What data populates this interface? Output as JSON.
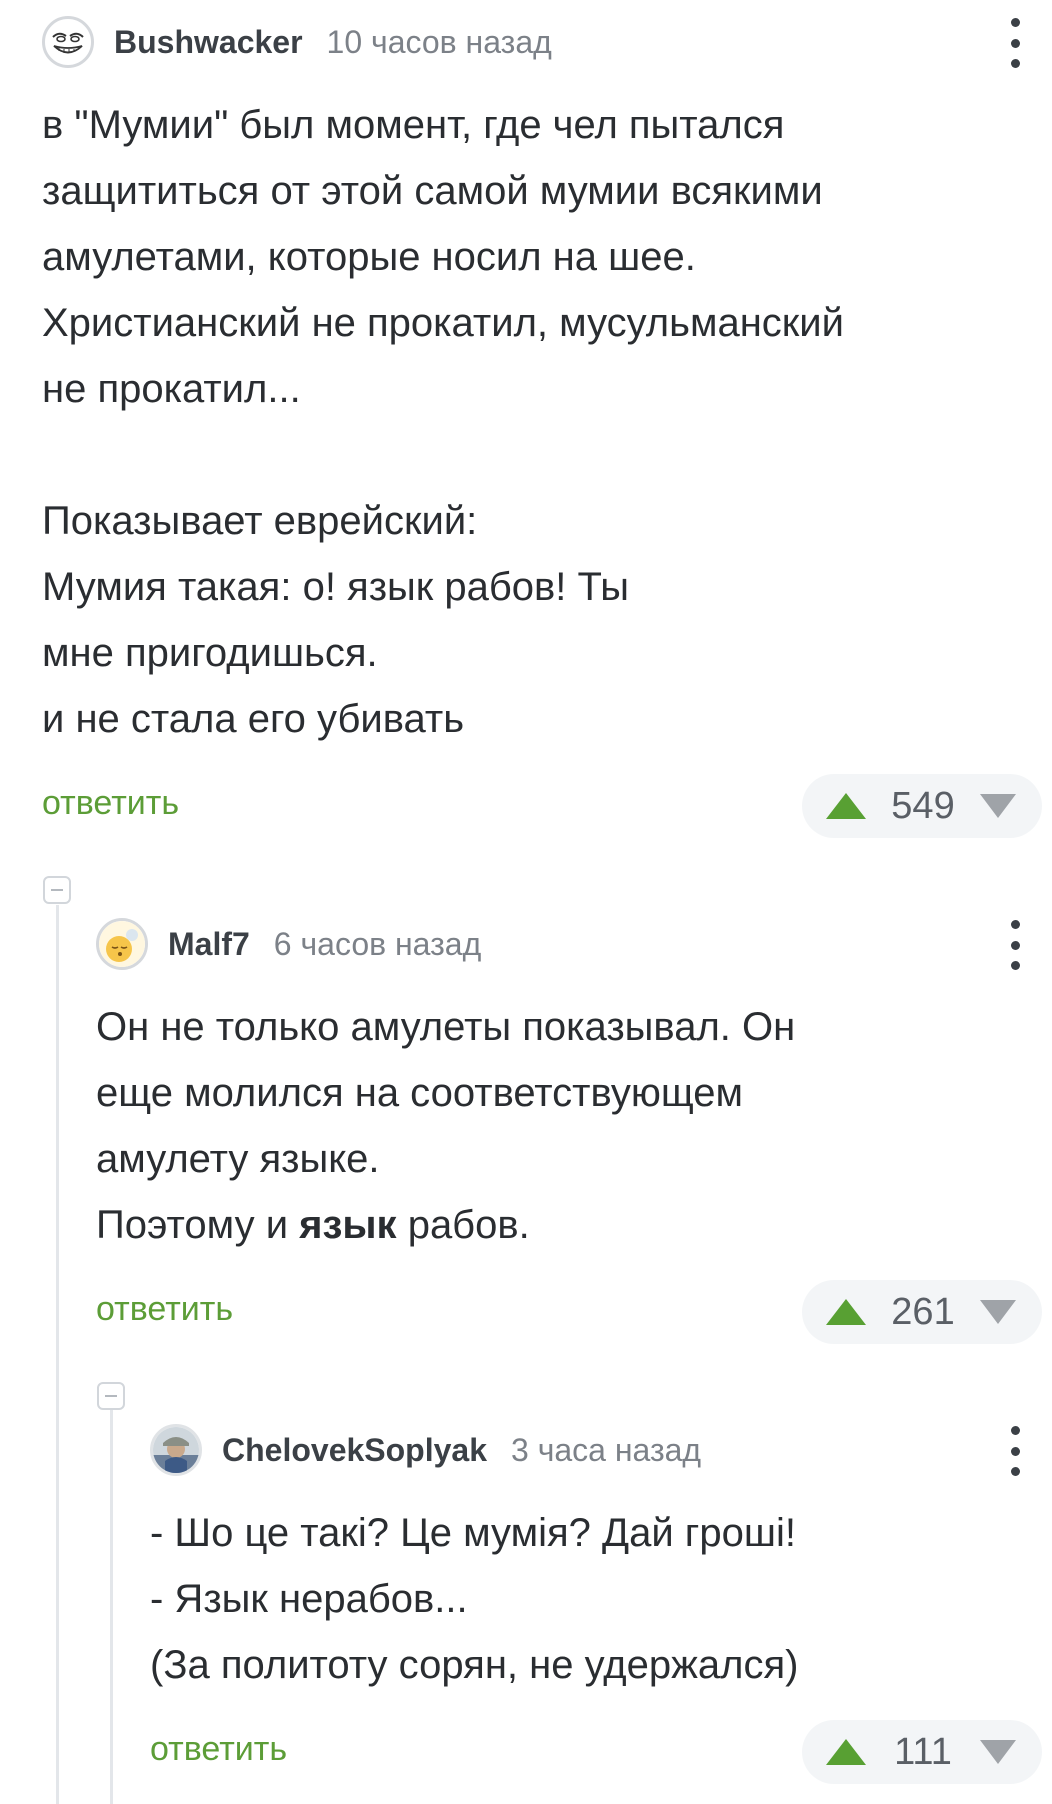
{
  "comments": [
    {
      "username": "Bushwacker",
      "time": "10 часов назад",
      "lines": [
        "в \"Мумии\" был момент, где чел пытался",
        "защититься от этой самой мумии всякими",
        "амулетами, которые носил на шее.",
        "Христианский не прокатил, мусульманский",
        "не прокатил...",
        "",
        "Показывает еврейский:",
        "Мумия такая: о! язык рабов! Ты",
        "мне пригодишься.",
        "и не стала его убивать"
      ],
      "reply_label": "ответить",
      "votes": "549"
    },
    {
      "username": "Malf7",
      "time": "6 часов назад",
      "lines": [
        "Он не только амулеты показывал. Он",
        "еще молился на соответствующем",
        "амулету языке."
      ],
      "last_line": {
        "before": "Поэтому и ",
        "bold": "язык",
        "after": " рабов."
      },
      "reply_label": "ответить",
      "votes": "261"
    },
    {
      "username": "ChelovekSoplyak",
      "time": "3 часа назад",
      "lines": [
        "- Шо це такі? Це мумія? Дай гроші!",
        "- Язык нерабов...",
        "(За политоту сорян, не удержался)"
      ],
      "reply_label": "ответить",
      "votes": "111"
    }
  ],
  "colors": {
    "reply": "#5c9d37",
    "upvote": "#58a033",
    "downvote": "#9fa3a8",
    "vote_bg": "#f3f5f7",
    "thread_line": "#e3e6ea"
  },
  "icons": {
    "avatar_1": "trollface-avatar",
    "avatar_2": "sleeping-emoji-avatar",
    "avatar_3": "photo-avatar",
    "menu": "more-vertical-icon",
    "upvote": "triangle-up-icon",
    "downvote": "triangle-down-icon",
    "collapse": "minus-box-icon"
  }
}
